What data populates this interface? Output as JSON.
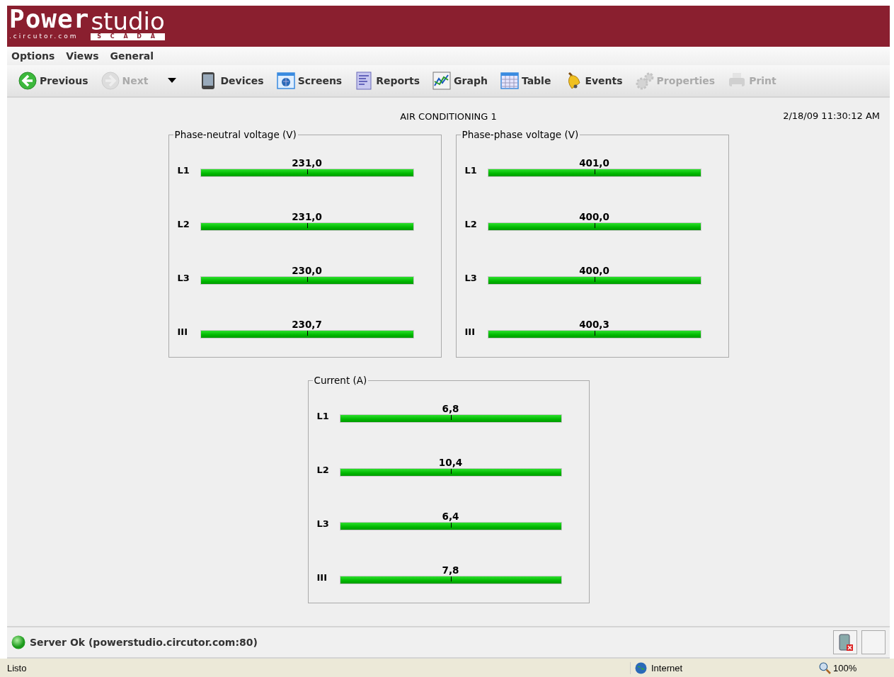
{
  "header": {
    "logo_main": "Power",
    "logo_sub": ".circutor.com",
    "logo_studio": "studio",
    "logo_scada": "S C A D A"
  },
  "menu": [
    "Options",
    "Views",
    "General"
  ],
  "toolbar": [
    {
      "label": "Previous",
      "disabled": false
    },
    {
      "label": "Next",
      "disabled": true
    },
    {
      "disabled": false,
      "kind": "dropdown"
    },
    {
      "label": "Devices",
      "disabled": false
    },
    {
      "label": "Screens",
      "disabled": false
    },
    {
      "label": "Reports",
      "disabled": false
    },
    {
      "label": "Graph",
      "disabled": false
    },
    {
      "label": "Table",
      "disabled": false
    },
    {
      "label": "Events",
      "disabled": false
    },
    {
      "label": "Properties",
      "disabled": true
    },
    {
      "label": "Print",
      "disabled": true
    }
  ],
  "screen": {
    "title": "AIR CONDITIONING 1",
    "datetime": "2/18/09 11:30:12 AM"
  },
  "panels": [
    {
      "title": "Phase-neutral voltage (V)",
      "rows": [
        {
          "label": "L1",
          "reading": "231,0",
          "level": 1
        },
        {
          "label": "L2",
          "reading": "231,0",
          "level": 1
        },
        {
          "label": "L3",
          "reading": "230,0",
          "level": 1
        },
        {
          "label": "III",
          "reading": "230,7",
          "level": 1
        }
      ]
    },
    {
      "title": "Phase-phase voltage (V)",
      "rows": [
        {
          "label": "L1",
          "reading": "401,0",
          "level": 1
        },
        {
          "label": "L2",
          "reading": "400,0",
          "level": 1
        },
        {
          "label": "L3",
          "reading": "400,0",
          "level": 1
        },
        {
          "label": "III",
          "reading": "400,3",
          "level": 1
        }
      ]
    },
    {
      "title": "Current (A)",
      "rows": [
        {
          "label": "L1",
          "reading": "6,8",
          "level": 1
        },
        {
          "label": "L2",
          "reading": "10,4",
          "level": 1
        },
        {
          "label": "L3",
          "reading": "6,4",
          "level": 1
        },
        {
          "label": "III",
          "reading": "7,8",
          "level": 1
        }
      ]
    }
  ],
  "server_status": "Server Ok (powerstudio.circutor.com:80)",
  "browser_status": {
    "text": "Listo",
    "zone": "Internet",
    "zoom": "100%"
  }
}
